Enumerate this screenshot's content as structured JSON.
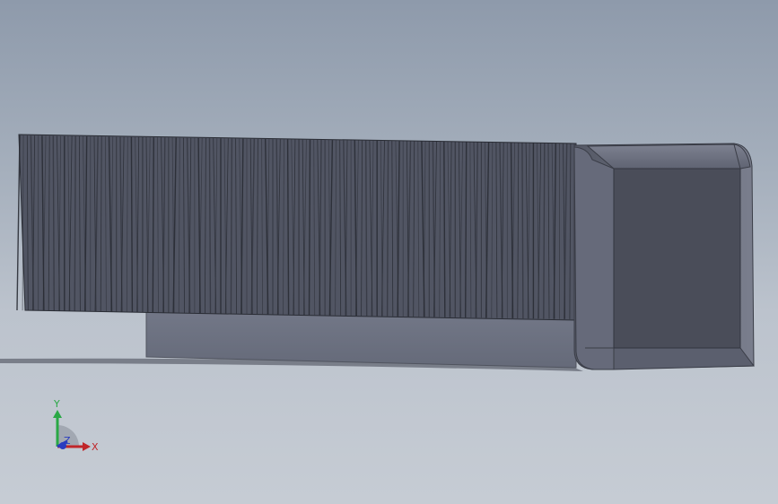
{
  "viewport": {
    "background_top": "#8e9aab",
    "background_bottom": "#c6ccd4"
  },
  "model": {
    "brush_color": "#4e525f",
    "bristle_line_color": "#2a2d35",
    "base_color": "#6e7383",
    "cap_face_color": "#494c58",
    "cap_bevel_color": "#6c7080"
  },
  "triad": {
    "x_label": "X",
    "y_label": "Y",
    "z_label": "Z",
    "x_color": "#c0262a",
    "y_color": "#2aa845",
    "z_color": "#2a3cc0"
  }
}
